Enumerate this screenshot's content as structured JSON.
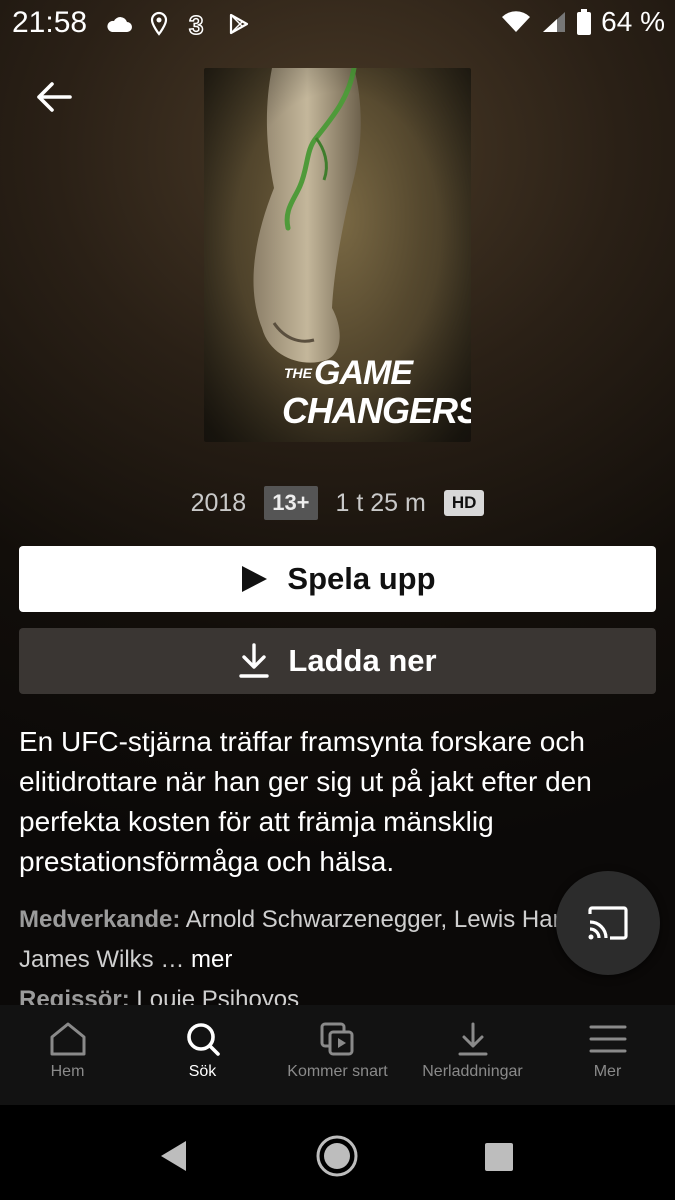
{
  "status_bar": {
    "time": "21:58",
    "battery_percent": "64 %",
    "left_icons": [
      "cloud-icon",
      "location-icon",
      "carrier-3-icon",
      "play-store-icon"
    ],
    "right_icons": [
      "wifi-icon",
      "signal-icon",
      "battery-icon"
    ]
  },
  "poster": {
    "title_the": "THE",
    "title_line1": "GAME",
    "title_line2": "CHANGERS"
  },
  "meta": {
    "year": "2018",
    "rating": "13+",
    "duration": "1 t 25 m",
    "quality": "HD"
  },
  "actions": {
    "play_label": "Spela upp",
    "download_label": "Ladda ner"
  },
  "synopsis": "En UFC-stjärna träffar framsynta forskare och elitidrottare när han ger sig ut på jakt efter den perfekta kosten för att främja mänsklig prestationsförmåga och hälsa.",
  "credits": {
    "cast_label": "Medverkande:",
    "cast_value": " Arnold Schwarzenegger, Lewis Hamilton, James Wilks … ",
    "more_label": "mer",
    "director_label": "Regissör:",
    "director_value": " Louie Psihoyos"
  },
  "bottom_nav": {
    "items": [
      {
        "label": "Hem",
        "icon": "home-icon"
      },
      {
        "label": "Sök",
        "icon": "search-icon",
        "active": true
      },
      {
        "label": "Kommer snart",
        "icon": "coming-soon-icon"
      },
      {
        "label": "Nerladdningar",
        "icon": "download-icon"
      },
      {
        "label": "Mer",
        "icon": "menu-icon"
      }
    ]
  },
  "colors": {
    "background_top": "#4a3a27",
    "play_button_bg": "#ffffff",
    "download_button_bg": "#3a3633",
    "nav_bg": "#121212",
    "nav_inactive": "#8a8a8a"
  }
}
